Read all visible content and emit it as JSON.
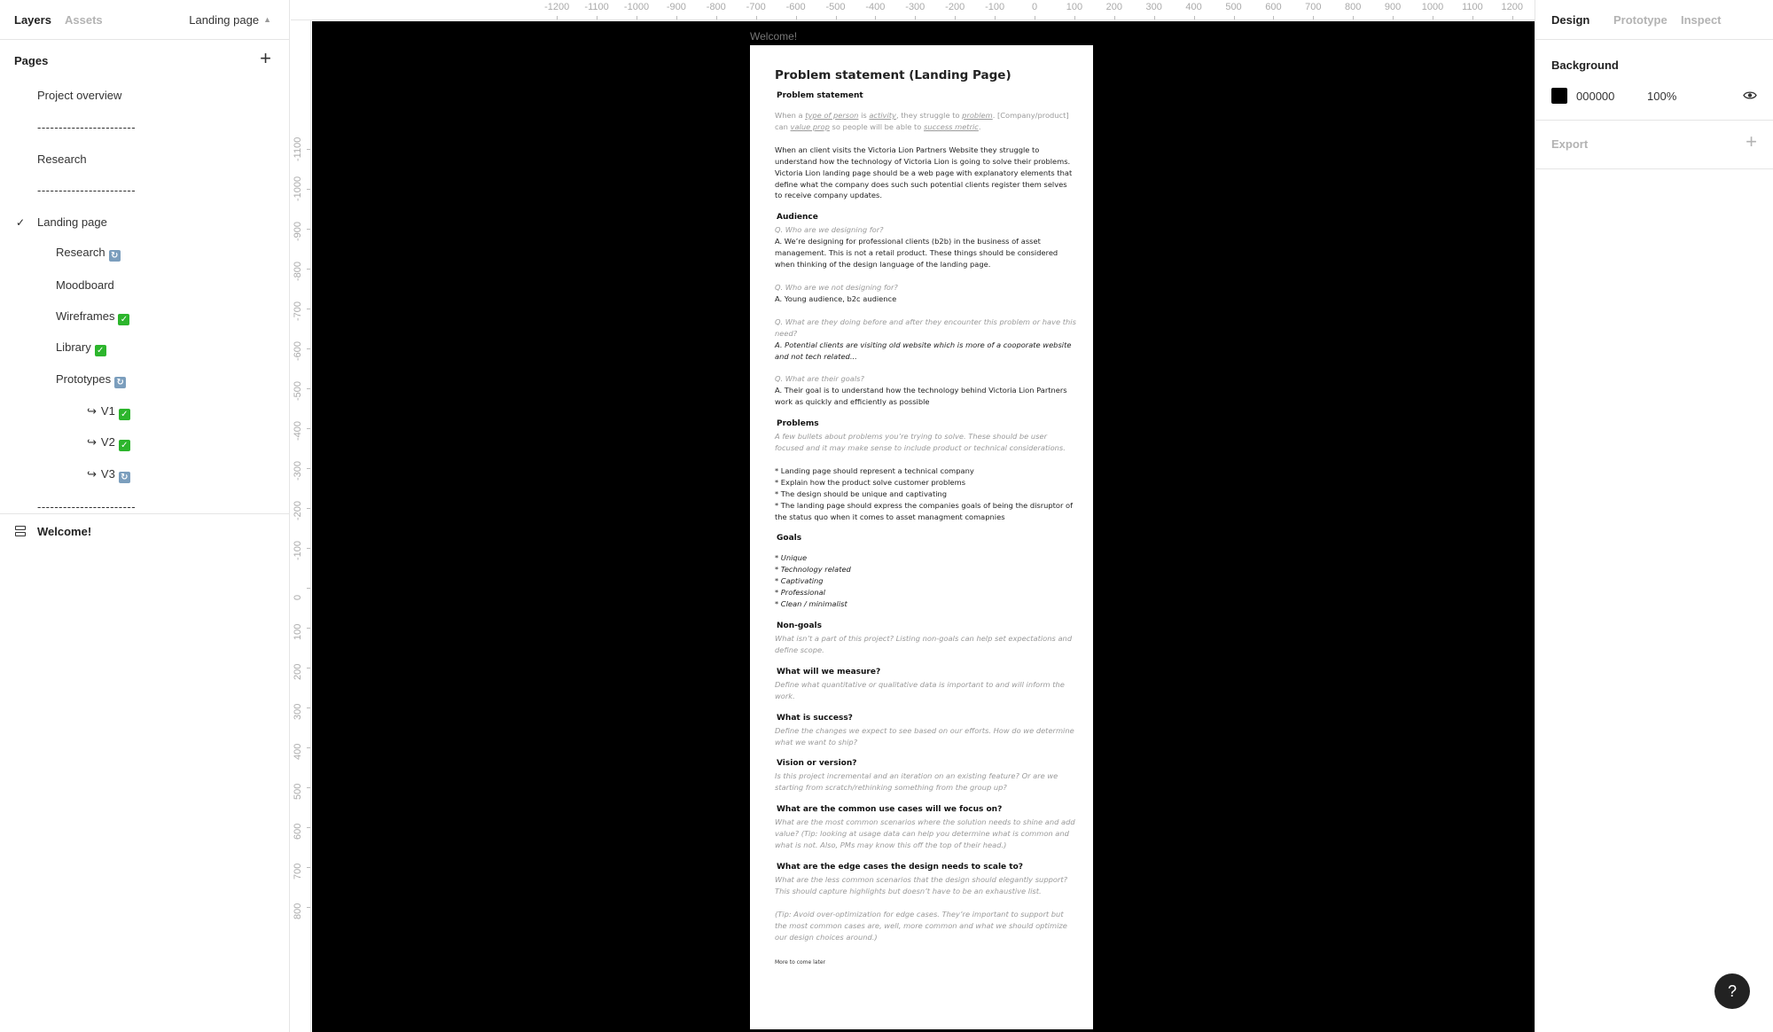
{
  "left_panel": {
    "tabs": {
      "layers": "Layers",
      "assets": "Assets"
    },
    "current_page": "Landing page",
    "pages_label": "Pages",
    "pages": [
      {
        "label": "Project overview",
        "level": 0,
        "status": null,
        "current": false,
        "sub": false
      },
      {
        "label": "-----------------------",
        "level": 0,
        "status": null,
        "current": false,
        "sub": false
      },
      {
        "label": "Research",
        "level": 0,
        "status": null,
        "current": false,
        "sub": false
      },
      {
        "label": "-----------------------",
        "level": 0,
        "status": null,
        "current": false,
        "sub": false
      },
      {
        "label": "Landing page",
        "level": 0,
        "status": null,
        "current": true,
        "sub": false
      },
      {
        "label": "Research",
        "level": 1,
        "status": "in-progress",
        "current": false,
        "sub": false
      },
      {
        "label": "Moodboard",
        "level": 1,
        "status": null,
        "current": false,
        "sub": false
      },
      {
        "label": "Wireframes",
        "level": 1,
        "status": "done",
        "current": false,
        "sub": false
      },
      {
        "label": "Library",
        "level": 1,
        "status": "done",
        "current": false,
        "sub": false
      },
      {
        "label": "Prototypes",
        "level": 1,
        "status": "in-progress",
        "current": false,
        "sub": false
      },
      {
        "label": "V1",
        "level": 2,
        "status": "done",
        "current": false,
        "sub": true
      },
      {
        "label": "V2",
        "level": 2,
        "status": "done",
        "current": false,
        "sub": true
      },
      {
        "label": "V3",
        "level": 2,
        "status": "in-progress",
        "current": false,
        "sub": true
      },
      {
        "label": "-----------------------",
        "level": 0,
        "status": null,
        "current": false,
        "sub": false
      }
    ],
    "layers": [
      {
        "name": "Welcome!",
        "icon": "frame-rows-icon"
      }
    ]
  },
  "rulers": {
    "top": [
      "-1200",
      "-1100",
      "-1000",
      "-900",
      "-800",
      "-700",
      "-600",
      "-500",
      "-400",
      "-300",
      "-200",
      "-100",
      "0",
      "100",
      "200",
      "300",
      "400",
      "500",
      "600",
      "700",
      "800",
      "900",
      "1000",
      "1100",
      "1200"
    ],
    "left": [
      "-1100",
      "-1000",
      "-900",
      "-800",
      "-700",
      "-600",
      "-500",
      "-400",
      "-300",
      "-200",
      "-100",
      "0",
      "100",
      "200",
      "300",
      "400",
      "500",
      "600",
      "700",
      "800"
    ]
  },
  "canvas": {
    "background": "#000000",
    "frame_label": "Welcome!",
    "doc": {
      "title": "Problem statement (Landing Page)",
      "ps_heading": "Problem statement",
      "template": {
        "p1": "When a ",
        "u1": "type of person",
        "p2": " is ",
        "u2": "activity",
        "p3": ", they struggle to ",
        "u3": "problem",
        "p4": ". [Company/product] can ",
        "u4": "value prop",
        "p5": " so people will be able to ",
        "u5": "success metric",
        "p6": "."
      },
      "ps_body": "When an client visits the Victoria Lion Partners Website they struggle to understand how the technology of Victoria Lion is going to solve their problems. Victoria Lion landing page should be a web page with explanatory elements that define what the company does such such potential clients register them selves to receive company updates.",
      "audience_heading": "Audience",
      "q1": "Q. Who are we designing for?",
      "a1": "A. We’re designing for professional clients (b2b) in the business of  asset management. This is not a retail product. These things should be considered when thinking of the design language of the landing page.",
      "q2": "Q. Who are we not designing for?",
      "a2": "A. Young audience, b2c audience",
      "q3": "Q. What are they doing before and after they encounter this problem or have this need?",
      "a3": "A. Potential clients are visiting old website which is more of a cooporate website and not tech related...",
      "q4": "Q. What are their goals?",
      "a4": "A. Their goal is to understand how the technology behind Victoria Lion Partners work as quickly and efficiently as possible",
      "problems_heading": "Problems",
      "problems_hint": "A few bullets about problems you’re trying to solve. These should be user focused and it may make sense to include product or technical considerations.",
      "problems": [
        "* Landing page should represent a technical company",
        "* Explain how the product solve customer problems",
        "* The design should be unique and captivating",
        "* The landing page should express the companies goals of being the disruptor of the status quo when it comes to asset managment comapnies"
      ],
      "goals_heading": "Goals",
      "goals": [
        "* Unique",
        "* Technology related",
        "* Captivating",
        "* Professional",
        "* Clean / minimalist"
      ],
      "sections": [
        {
          "heading": "Non-goals",
          "hint": "What isn’t a part of this project? Listing non-goals can help set expectations and define scope."
        },
        {
          "heading": "What will we measure?",
          "hint": "Define what quantitative or qualitative data is important to and will inform the work."
        },
        {
          "heading": "What is success?",
          "hint": "Define the changes we expect to see based on our efforts. How do we determine what we want to ship?"
        },
        {
          "heading": "Vision or version?",
          "hint": "Is this project incremental and an iteration on an existing feature? Or are we starting from scratch/rethinking something from the group up?"
        },
        {
          "heading": "What are the common use cases will we focus on?",
          "hint": "What are the most common scenarios where the solution needs to shine and add value? (Tip: looking at usage data can help you determine what is common and what is not. Also, PMs may know this off the top of their head.)"
        },
        {
          "heading": "What are the edge cases the design needs to scale to?",
          "hint": "What are the less common scenarios that the design should elegantly support? This should capture highlights but doesn’t have to be an exhaustive list."
        }
      ],
      "edge_tip": "(Tip: Avoid over-optimization for edge cases. They’re important to support but the most common cases are, well, more common and what we should optimize our design choices around.)",
      "footer": "More to come later"
    }
  },
  "right_panel": {
    "tabs": {
      "design": "Design",
      "prototype": "Prototype",
      "inspect": "Inspect"
    },
    "background": {
      "title": "Background",
      "hex": "000000",
      "opacity": "100%",
      "swatch_color": "#000000"
    },
    "export": {
      "title": "Export"
    }
  },
  "help_button": "?"
}
